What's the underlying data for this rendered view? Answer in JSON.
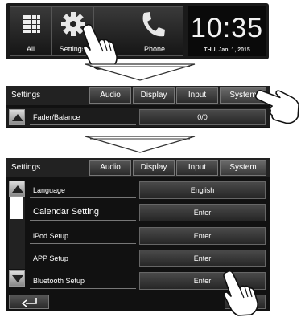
{
  "home": {
    "tiles": [
      {
        "label": "All",
        "icon": "grid-icon"
      },
      {
        "label": "Settings",
        "icon": "gear-icon"
      },
      {
        "label": "Phone",
        "icon": "phone-icon"
      }
    ],
    "clock": "10:35",
    "date": "THU, Jan. 1, 2015"
  },
  "step2": {
    "title": "Settings",
    "tabs": [
      "Audio",
      "Display",
      "Input",
      "System"
    ],
    "active_tab": "System",
    "row": {
      "label": "Fader/Balance",
      "value": "0/0"
    }
  },
  "step3": {
    "title": "Settings",
    "tabs": [
      "Audio",
      "Display",
      "Input",
      "System"
    ],
    "items": [
      {
        "label": "Language",
        "value": "English"
      },
      {
        "label": "Calendar Setting",
        "value": "Enter"
      },
      {
        "label": "iPod Setup",
        "value": "Enter"
      },
      {
        "label": "APP Setup",
        "value": "Enter"
      },
      {
        "label": "Bluetooth Setup",
        "value": "Enter"
      }
    ],
    "back_icon": "back-arrow-icon"
  }
}
